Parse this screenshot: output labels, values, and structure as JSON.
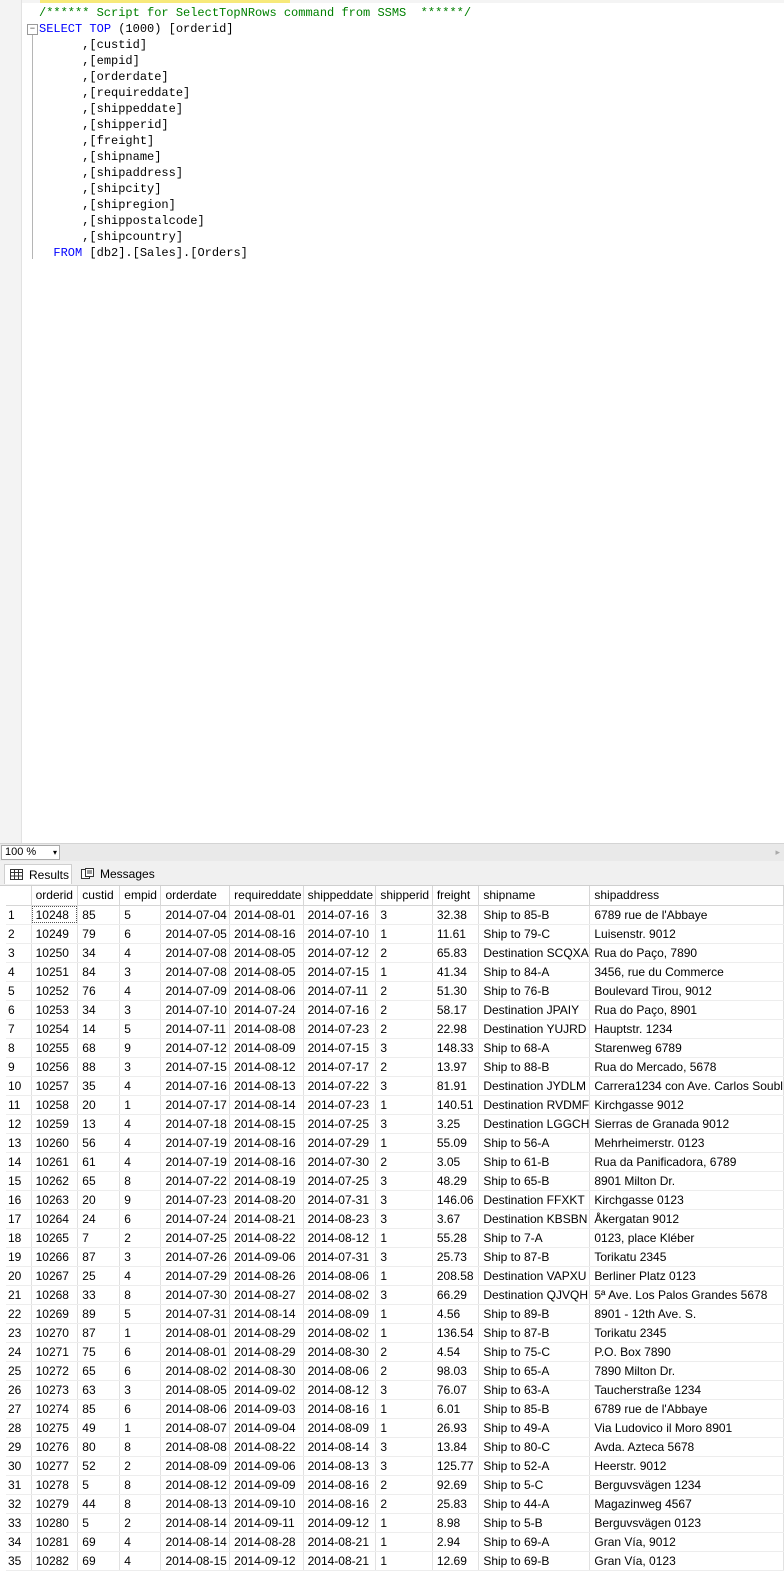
{
  "editor": {
    "comment": "/****** Script for SelectTopNRows command from SSMS  ******/",
    "select_kw": "SELECT",
    "top_kw": "TOP",
    "top_value": "(1000)",
    "first_col": "[orderid]",
    "columns": [
      ",[custid]",
      ",[empid]",
      ",[orderdate]",
      ",[requireddate]",
      ",[shippeddate]",
      ",[shipperid]",
      ",[freight]",
      ",[shipname]",
      ",[shipaddress]",
      ",[shipcity]",
      ",[shipregion]",
      ",[shippostalcode]",
      ",[shipcountry]"
    ],
    "from_kw": "FROM",
    "table": "[db2].[Sales].[Orders]",
    "fold_glyph": "−"
  },
  "zoom": {
    "value": "100 %",
    "arrow": "▾",
    "scroll_right": "▸"
  },
  "tabs": {
    "results": "Results",
    "messages": "Messages"
  },
  "grid": {
    "headers": [
      "orderid",
      "custid",
      "empid",
      "orderdate",
      "requireddate",
      "shippeddate",
      "shipperid",
      "freight",
      "shipname",
      "shipaddress"
    ],
    "rows": [
      [
        "1",
        "10248",
        "85",
        "5",
        "2014-07-04",
        "2014-08-01",
        "2014-07-16",
        "3",
        "32.38",
        "Ship to 85-B",
        "6789 rue de l'Abbaye"
      ],
      [
        "2",
        "10249",
        "79",
        "6",
        "2014-07-05",
        "2014-08-16",
        "2014-07-10",
        "1",
        "11.61",
        "Ship to 79-C",
        "Luisenstr. 9012"
      ],
      [
        "3",
        "10250",
        "34",
        "4",
        "2014-07-08",
        "2014-08-05",
        "2014-07-12",
        "2",
        "65.83",
        "Destination SCQXA",
        "Rua do Paço, 7890"
      ],
      [
        "4",
        "10251",
        "84",
        "3",
        "2014-07-08",
        "2014-08-05",
        "2014-07-15",
        "1",
        "41.34",
        "Ship to 84-A",
        "3456, rue du Commerce"
      ],
      [
        "5",
        "10252",
        "76",
        "4",
        "2014-07-09",
        "2014-08-06",
        "2014-07-11",
        "2",
        "51.30",
        "Ship to 76-B",
        "Boulevard Tirou, 9012"
      ],
      [
        "6",
        "10253",
        "34",
        "3",
        "2014-07-10",
        "2014-07-24",
        "2014-07-16",
        "2",
        "58.17",
        "Destination JPAIY",
        "Rua do Paço, 8901"
      ],
      [
        "7",
        "10254",
        "14",
        "5",
        "2014-07-11",
        "2014-08-08",
        "2014-07-23",
        "2",
        "22.98",
        "Destination YUJRD",
        "Hauptstr. 1234"
      ],
      [
        "8",
        "10255",
        "68",
        "9",
        "2014-07-12",
        "2014-08-09",
        "2014-07-15",
        "3",
        "148.33",
        "Ship to 68-A",
        "Starenweg 6789"
      ],
      [
        "9",
        "10256",
        "88",
        "3",
        "2014-07-15",
        "2014-08-12",
        "2014-07-17",
        "2",
        "13.97",
        "Ship to 88-B",
        "Rua do Mercado, 5678"
      ],
      [
        "10",
        "10257",
        "35",
        "4",
        "2014-07-16",
        "2014-08-13",
        "2014-07-22",
        "3",
        "81.91",
        "Destination JYDLM",
        "Carrera1234 con Ave. Carlos Soubl"
      ],
      [
        "11",
        "10258",
        "20",
        "1",
        "2014-07-17",
        "2014-08-14",
        "2014-07-23",
        "1",
        "140.51",
        "Destination RVDMF",
        "Kirchgasse 9012"
      ],
      [
        "12",
        "10259",
        "13",
        "4",
        "2014-07-18",
        "2014-08-15",
        "2014-07-25",
        "3",
        "3.25",
        "Destination LGGCH",
        "Sierras de Granada 9012"
      ],
      [
        "13",
        "10260",
        "56",
        "4",
        "2014-07-19",
        "2014-08-16",
        "2014-07-29",
        "1",
        "55.09",
        "Ship to 56-A",
        "Mehrheimerstr. 0123"
      ],
      [
        "14",
        "10261",
        "61",
        "4",
        "2014-07-19",
        "2014-08-16",
        "2014-07-30",
        "2",
        "3.05",
        "Ship to 61-B",
        "Rua da Panificadora, 6789"
      ],
      [
        "15",
        "10262",
        "65",
        "8",
        "2014-07-22",
        "2014-08-19",
        "2014-07-25",
        "3",
        "48.29",
        "Ship to 65-B",
        "8901 Milton Dr."
      ],
      [
        "16",
        "10263",
        "20",
        "9",
        "2014-07-23",
        "2014-08-20",
        "2014-07-31",
        "3",
        "146.06",
        "Destination FFXKT",
        "Kirchgasse 0123"
      ],
      [
        "17",
        "10264",
        "24",
        "6",
        "2014-07-24",
        "2014-08-21",
        "2014-08-23",
        "3",
        "3.67",
        "Destination KBSBN",
        "Åkergatan 9012"
      ],
      [
        "18",
        "10265",
        "7",
        "2",
        "2014-07-25",
        "2014-08-22",
        "2014-08-12",
        "1",
        "55.28",
        "Ship to 7-A",
        "0123, place Kléber"
      ],
      [
        "19",
        "10266",
        "87",
        "3",
        "2014-07-26",
        "2014-09-06",
        "2014-07-31",
        "3",
        "25.73",
        "Ship to 87-B",
        "Torikatu 2345"
      ],
      [
        "20",
        "10267",
        "25",
        "4",
        "2014-07-29",
        "2014-08-26",
        "2014-08-06",
        "1",
        "208.58",
        "Destination VAPXU",
        "Berliner Platz 0123"
      ],
      [
        "21",
        "10268",
        "33",
        "8",
        "2014-07-30",
        "2014-08-27",
        "2014-08-02",
        "3",
        "66.29",
        "Destination QJVQH",
        "5ª Ave. Los Palos Grandes 5678"
      ],
      [
        "22",
        "10269",
        "89",
        "5",
        "2014-07-31",
        "2014-08-14",
        "2014-08-09",
        "1",
        "4.56",
        "Ship to 89-B",
        "8901 - 12th Ave. S."
      ],
      [
        "23",
        "10270",
        "87",
        "1",
        "2014-08-01",
        "2014-08-29",
        "2014-08-02",
        "1",
        "136.54",
        "Ship to 87-B",
        "Torikatu 2345"
      ],
      [
        "24",
        "10271",
        "75",
        "6",
        "2014-08-01",
        "2014-08-29",
        "2014-08-30",
        "2",
        "4.54",
        "Ship to 75-C",
        "P.O. Box 7890"
      ],
      [
        "25",
        "10272",
        "65",
        "6",
        "2014-08-02",
        "2014-08-30",
        "2014-08-06",
        "2",
        "98.03",
        "Ship to 65-A",
        "7890 Milton Dr."
      ],
      [
        "26",
        "10273",
        "63",
        "3",
        "2014-08-05",
        "2014-09-02",
        "2014-08-12",
        "3",
        "76.07",
        "Ship to 63-A",
        "Taucherstraße 1234"
      ],
      [
        "27",
        "10274",
        "85",
        "6",
        "2014-08-06",
        "2014-09-03",
        "2014-08-16",
        "1",
        "6.01",
        "Ship to 85-B",
        "6789 rue de l'Abbaye"
      ],
      [
        "28",
        "10275",
        "49",
        "1",
        "2014-08-07",
        "2014-09-04",
        "2014-08-09",
        "1",
        "26.93",
        "Ship to 49-A",
        "Via Ludovico il Moro 8901"
      ],
      [
        "29",
        "10276",
        "80",
        "8",
        "2014-08-08",
        "2014-08-22",
        "2014-08-14",
        "3",
        "13.84",
        "Ship to 80-C",
        "Avda. Azteca 5678"
      ],
      [
        "30",
        "10277",
        "52",
        "2",
        "2014-08-09",
        "2014-09-06",
        "2014-08-13",
        "3",
        "125.77",
        "Ship to 52-A",
        "Heerstr. 9012"
      ],
      [
        "31",
        "10278",
        "5",
        "8",
        "2014-08-12",
        "2014-09-09",
        "2014-08-16",
        "2",
        "92.69",
        "Ship to 5-C",
        "Berguvsvägen  1234"
      ],
      [
        "32",
        "10279",
        "44",
        "8",
        "2014-08-13",
        "2014-09-10",
        "2014-08-16",
        "2",
        "25.83",
        "Ship to 44-A",
        "Magazinweg 4567"
      ],
      [
        "33",
        "10280",
        "5",
        "2",
        "2014-08-14",
        "2014-09-11",
        "2014-09-12",
        "1",
        "8.98",
        "Ship to 5-B",
        "Berguvsvägen  0123"
      ],
      [
        "34",
        "10281",
        "69",
        "4",
        "2014-08-14",
        "2014-08-28",
        "2014-08-21",
        "1",
        "2.94",
        "Ship to 69-A",
        "Gran Vía, 9012"
      ],
      [
        "35",
        "10282",
        "69",
        "4",
        "2014-08-15",
        "2014-09-12",
        "2014-08-21",
        "1",
        "12.69",
        "Ship to 69-B",
        "Gran Vía, 0123"
      ]
    ]
  }
}
